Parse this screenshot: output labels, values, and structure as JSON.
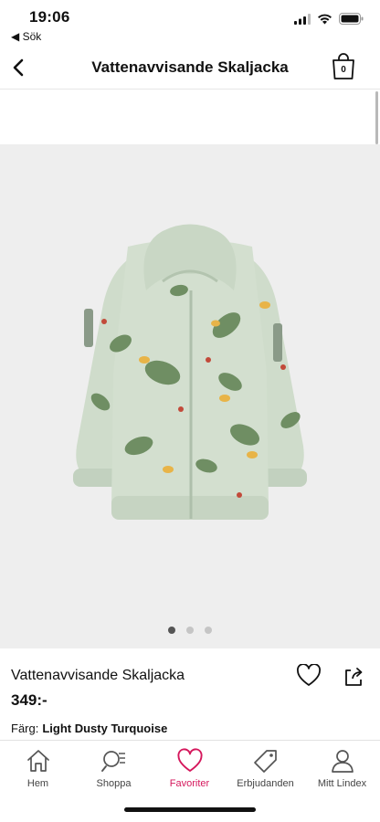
{
  "status_bar": {
    "time": "19:06",
    "back_app": "◀ Sök"
  },
  "header": {
    "title": "Vattenavvisande Skaljacka",
    "cart_count": "0"
  },
  "gallery": {
    "image_count": 3,
    "active_index": 0
  },
  "product": {
    "name": "Vattenavvisande Skaljacka",
    "price": "349:-",
    "color_label": "Färg:",
    "color_value": "Light Dusty Turquoise"
  },
  "bottom_nav": {
    "items": [
      {
        "label": "Hem",
        "icon": "home-icon"
      },
      {
        "label": "Shoppa",
        "icon": "search-list-icon"
      },
      {
        "label": "Favoriter",
        "icon": "heart-icon",
        "active": true
      },
      {
        "label": "Erbjudanden",
        "icon": "tag-icon"
      },
      {
        "label": "Mitt Lindex",
        "icon": "person-icon"
      }
    ],
    "active_color": "#d5175c"
  }
}
